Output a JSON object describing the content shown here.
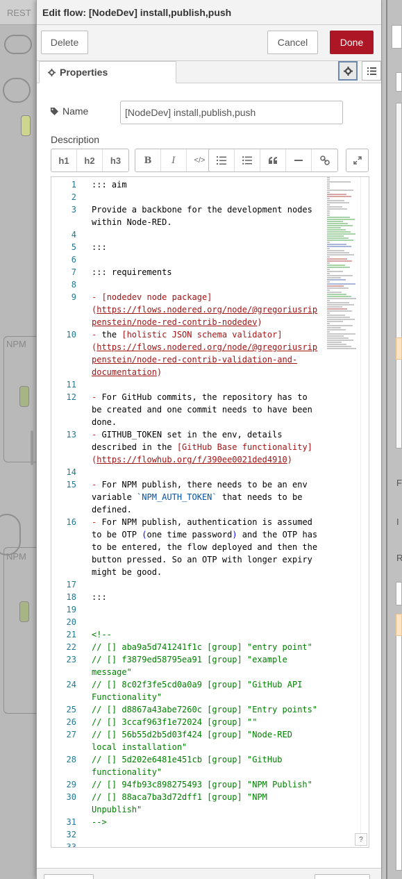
{
  "canvas": {
    "tab_label": "REST",
    "group_labels": [
      "NPM",
      "NPM"
    ]
  },
  "editor": {
    "title": "Edit flow: [NodeDev] install,publish,push",
    "buttons": {
      "delete": "Delete",
      "cancel": "Cancel",
      "done": "Done"
    },
    "tabs": {
      "properties": "Properties"
    },
    "name_label": "Name",
    "name_value": "[NodeDev] install,publish,push",
    "description_label": "Description",
    "md_toolbar": {
      "h1": "h1",
      "h2": "h2",
      "h3": "h3",
      "bold": "B",
      "italic": "I",
      "code": "</>",
      "ordered_list": "≡",
      "unordered_list": "☰",
      "quote": "❝",
      "rule": "—",
      "link": "🔗",
      "expand": "⤢"
    },
    "help_label": "?"
  },
  "code_lines": [
    {
      "n": "1",
      "t": "::: aim"
    },
    {
      "n": "2",
      "t": ""
    },
    {
      "n": "3",
      "t": "Provide a backbone for the development nodes within Node-RED."
    },
    {
      "n": "4",
      "t": ""
    },
    {
      "n": "5",
      "t": ":::"
    },
    {
      "n": "6",
      "t": ""
    },
    {
      "n": "7",
      "t": "::: requirements"
    },
    {
      "n": "8",
      "t": ""
    },
    {
      "n": "9",
      "t": "- [nodedev node package](https://flows.nodered.org/node/@gregoriusrippenstein/node-red-contrib-nodedev)"
    },
    {
      "n": "10",
      "t": "- the [holistic JSON schema validator](https://flows.nodered.org/node/@gregoriusrippenstein/node-red-contrib-validation-and-documentation)"
    },
    {
      "n": "11",
      "t": ""
    },
    {
      "n": "12",
      "t": "- For GitHub commits, the repository has to be created and one commit needs to have been done."
    },
    {
      "n": "13",
      "t": "- GITHUB_TOKEN set in the env, details described in the [GitHub Base functionality](https://flowhub.org/f/390ee0021ded4910)"
    },
    {
      "n": "14",
      "t": ""
    },
    {
      "n": "15",
      "t": "- For NPM publish, there needs to be an env variable `NPM_AUTH_TOKEN` that needs to be defined."
    },
    {
      "n": "16",
      "t": "- For NPM publish, authentication is assumed to be OTP (one time password) and the OTP has to be entered, the flow deployed and then the button pressed. So an OTP with longer expiry might be good."
    },
    {
      "n": "17",
      "t": ""
    },
    {
      "n": "18",
      "t": ":::"
    },
    {
      "n": "19",
      "t": ""
    },
    {
      "n": "20",
      "t": ""
    },
    {
      "n": "21",
      "t": "<!--"
    },
    {
      "n": "22",
      "t": "// [] aba9a5d741241f1c [group] \"entry point\""
    },
    {
      "n": "23",
      "t": "// [] f3879ed58795ea91 [group] \"example message\""
    },
    {
      "n": "24",
      "t": "// [] 8c02f3fe5cd0a0a9 [group] \"GitHub API Functionality\""
    },
    {
      "n": "25",
      "t": "// [] d8867a43abe7260c [group] \"Entry points\""
    },
    {
      "n": "26",
      "t": "// [] 3ccaf963f1e72024 [group] \"\""
    },
    {
      "n": "27",
      "t": "// [] 56b55d2b5d03f424 [group] \"Node-RED local installation\""
    },
    {
      "n": "28",
      "t": "// [] 5d202e6481e451cb [group] \"GitHub functionality\""
    },
    {
      "n": "29",
      "t": "// [] 94fb93c898275493 [group] \"NPM Publish\""
    },
    {
      "n": "30",
      "t": "// [] 88aca7ba3d72dff1 [group] \"NPM Unpublish\""
    },
    {
      "n": "31",
      "t": "-->"
    },
    {
      "n": "32",
      "t": ""
    },
    {
      "n": "33",
      "t": ""
    }
  ],
  "sidebar": {
    "labels": [
      "F",
      "I",
      "R"
    ]
  },
  "colors": {
    "done_button": "#ad1625",
    "line_numbers": "#237893",
    "comment": "#008000",
    "link": "#a31515"
  }
}
